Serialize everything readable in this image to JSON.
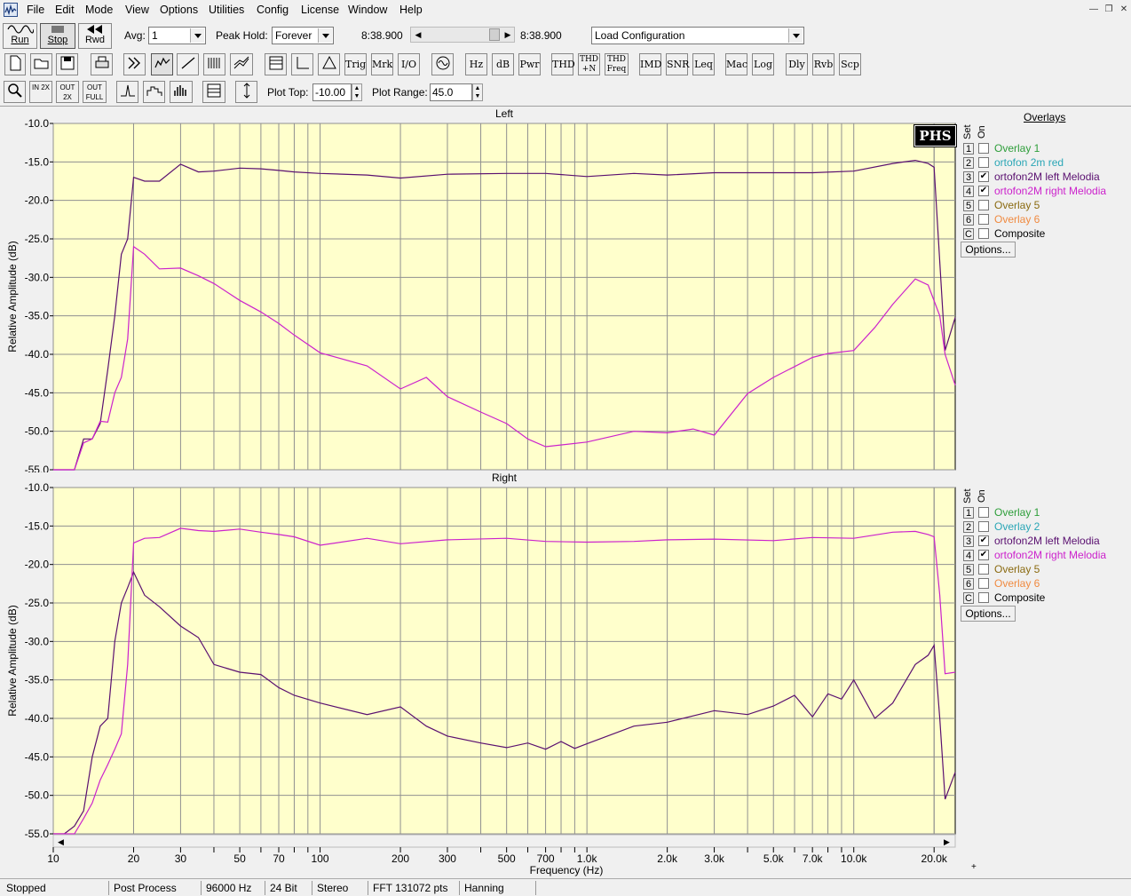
{
  "menu": [
    "File",
    "Edit",
    "Mode",
    "View",
    "Options",
    "Utilities",
    "Config",
    "License",
    "Window",
    "Help"
  ],
  "toolbar1": {
    "run_label": "Run",
    "stop_label": "Stop",
    "rwd_label": "Rwd",
    "avg_label": "Avg:",
    "avg_value": "1",
    "peak_hold_label": "Peak Hold:",
    "peak_hold_value": "Forever",
    "time_start": "8:38.900",
    "time_end": "8:38.900",
    "config_value": "Load Configuration"
  },
  "toolbar2": [
    "Trig",
    "Mrk",
    "I/O",
    "Hz",
    "dB",
    "Pwr",
    "THD",
    "THD +N",
    "THD Freq",
    "IMD",
    "SNR",
    "Leq",
    "Mac",
    "Log",
    "Dly",
    "Rvb",
    "Scp"
  ],
  "toolbar3": {
    "zoom_in_label": "IN 2X",
    "zoom_out_label": "OUT 2X",
    "zoom_full_label": "OUT FULL",
    "plot_top_label": "Plot Top:",
    "plot_top_value": "-10.00",
    "plot_range_label": "Plot Range:",
    "plot_range_value": "45.0"
  },
  "plots": {
    "left_title": "Left",
    "right_title": "Right",
    "ylabel": "Relative Amplitude (dB)",
    "xlabel": "Frequency (Hz)",
    "logo": "PHS",
    "yticks": [
      "-10.0",
      "-15.0",
      "-20.0",
      "-25.0",
      "-30.0",
      "-35.0",
      "-40.0",
      "-45.0",
      "-50.0",
      "-55.0"
    ],
    "xticks": [
      "10",
      "20",
      "30",
      "50",
      "70",
      "100",
      "200",
      "300",
      "500",
      "700",
      "1.0k",
      "2.0k",
      "3.0k",
      "5.0k",
      "7.0k",
      "10.0k",
      "20.0k"
    ]
  },
  "overlays": {
    "title": "Overlays",
    "set_label": "Set",
    "on_label": "On",
    "options_label": "Options...",
    "left": [
      {
        "num": "1",
        "label": "Overlay 1",
        "checked": false,
        "color": "#2e9e3a"
      },
      {
        "num": "2",
        "label": "ortofon 2m red",
        "checked": false,
        "color": "#2aa6b6"
      },
      {
        "num": "3",
        "label": "ortofon2M left Melodia",
        "checked": true,
        "color": "#5a1070"
      },
      {
        "num": "4",
        "label": "ortofon2M right Melodia",
        "checked": true,
        "color": "#cc22cc"
      },
      {
        "num": "5",
        "label": "Overlay 5",
        "checked": false,
        "color": "#8a6a10"
      },
      {
        "num": "6",
        "label": "Overlay 6",
        "checked": false,
        "color": "#f08a40"
      },
      {
        "num": "C",
        "label": "Composite",
        "checked": false,
        "color": "#000000"
      }
    ],
    "right": [
      {
        "num": "1",
        "label": "Overlay 1",
        "checked": false,
        "color": "#2e9e3a"
      },
      {
        "num": "2",
        "label": "Overlay 2",
        "checked": false,
        "color": "#2aa6b6"
      },
      {
        "num": "3",
        "label": "ortofon2M left Melodia",
        "checked": true,
        "color": "#5a1070"
      },
      {
        "num": "4",
        "label": "ortofon2M right Melodia",
        "checked": true,
        "color": "#cc22cc"
      },
      {
        "num": "5",
        "label": "Overlay 5",
        "checked": false,
        "color": "#8a6a10"
      },
      {
        "num": "6",
        "label": "Overlay 6",
        "checked": false,
        "color": "#f08a40"
      },
      {
        "num": "C",
        "label": "Composite",
        "checked": false,
        "color": "#000000"
      }
    ]
  },
  "status": [
    "Stopped",
    "Post Process",
    "96000 Hz",
    "24 Bit",
    "Stereo",
    "FFT 131072 pts",
    "Hanning"
  ],
  "colors": {
    "plot_bg": "#ffffcc",
    "grid": "#909090",
    "series_dark": "#5a1070",
    "series_magenta": "#cc22cc"
  },
  "chart_data": [
    {
      "type": "line",
      "title": "Left",
      "xlabel": "Frequency (Hz)",
      "ylabel": "Relative Amplitude (dB)",
      "xscale": "log",
      "xlim": [
        10,
        24000
      ],
      "ylim": [
        -55,
        -10
      ],
      "series": [
        {
          "name": "ortofon2M left Melodia",
          "color": "#5a1070",
          "x": [
            10,
            11,
            12,
            13,
            14,
            15,
            16,
            17,
            18,
            19,
            20,
            22,
            25,
            30,
            35,
            40,
            50,
            60,
            70,
            80,
            100,
            150,
            200,
            300,
            500,
            700,
            1000,
            1500,
            2000,
            3000,
            5000,
            7000,
            10000,
            14000,
            17000,
            19000,
            20000,
            21000,
            22000,
            24000
          ],
          "y": [
            -55,
            -55,
            -55,
            -51,
            -51,
            -49,
            -42,
            -35,
            -27,
            -25,
            -17,
            -17.5,
            -17.5,
            -15.3,
            -16.3,
            -16.2,
            -15.8,
            -15.9,
            -16.1,
            -16.3,
            -16.5,
            -16.7,
            -17.1,
            -16.6,
            -16.5,
            -16.5,
            -16.9,
            -16.5,
            -16.7,
            -16.4,
            -16.4,
            -16.4,
            -16.2,
            -15.2,
            -14.8,
            -15.2,
            -15.7,
            -28,
            -39.5,
            -35.2
          ]
        },
        {
          "name": "ortofon2M right Melodia",
          "color": "#cc22cc",
          "x": [
            10,
            11,
            12,
            13,
            14,
            15,
            16,
            17,
            18,
            19,
            20,
            22,
            25,
            30,
            35,
            40,
            50,
            60,
            70,
            80,
            100,
            150,
            200,
            250,
            300,
            400,
            500,
            600,
            700,
            1000,
            1500,
            2000,
            2500,
            3000,
            4000,
            5000,
            7000,
            8000,
            10000,
            12000,
            14000,
            17000,
            19000,
            21000,
            22000,
            24000
          ],
          "y": [
            -55,
            -55,
            -55,
            -51.5,
            -51,
            -48.7,
            -48.8,
            -45,
            -43,
            -38,
            -26,
            -27,
            -28.9,
            -28.8,
            -29.8,
            -30.8,
            -33,
            -34.5,
            -36,
            -37.5,
            -39.8,
            -41.5,
            -44.5,
            -43,
            -45.5,
            -47.5,
            -49,
            -51,
            -52,
            -51.4,
            -50,
            -50.2,
            -49.7,
            -50.5,
            -45.1,
            -43,
            -40.4,
            -39.9,
            -39.5,
            -36.5,
            -33.5,
            -30.2,
            -31,
            -35,
            -40,
            -44
          ]
        }
      ]
    },
    {
      "type": "line",
      "title": "Right",
      "xlabel": "Frequency (Hz)",
      "ylabel": "Relative Amplitude (dB)",
      "xscale": "log",
      "xlim": [
        10,
        24000
      ],
      "ylim": [
        -55,
        -10
      ],
      "series": [
        {
          "name": "ortofon2M left Melodia",
          "color": "#5a1070",
          "x": [
            10,
            11,
            12,
            13,
            14,
            15,
            16,
            17,
            18,
            19,
            20,
            22,
            25,
            30,
            35,
            40,
            50,
            60,
            70,
            80,
            100,
            150,
            200,
            250,
            300,
            400,
            500,
            600,
            700,
            800,
            900,
            1000,
            1500,
            2000,
            3000,
            4000,
            5000,
            6000,
            7000,
            8000,
            9000,
            10000,
            12000,
            14000,
            17000,
            19000,
            20000,
            21000,
            22000,
            24000
          ],
          "y": [
            -55,
            -55,
            -54,
            -52,
            -45,
            -41,
            -40,
            -30,
            -25,
            -23,
            -21,
            -24,
            -25.5,
            -28,
            -29.5,
            -33,
            -34,
            -34.3,
            -36,
            -37,
            -38,
            -39.5,
            -38.5,
            -41,
            -42.3,
            -43.2,
            -43.8,
            -43.2,
            -44,
            -43,
            -43.9,
            -43.3,
            -41,
            -40.5,
            -39,
            -39.5,
            -38.4,
            -37,
            -39.8,
            -36.8,
            -37.5,
            -35,
            -40,
            -38,
            -33,
            -31.8,
            -30.5,
            -40,
            -50.5,
            -47
          ]
        },
        {
          "name": "ortofon2M right Melodia",
          "color": "#cc22cc",
          "x": [
            10,
            11,
            12,
            13,
            14,
            15,
            16,
            17,
            18,
            19,
            20,
            22,
            25,
            30,
            35,
            40,
            50,
            60,
            70,
            80,
            100,
            150,
            200,
            300,
            500,
            700,
            1000,
            1500,
            2000,
            3000,
            5000,
            7000,
            10000,
            14000,
            17000,
            19000,
            20000,
            21000,
            22000,
            24000
          ],
          "y": [
            -55,
            -55,
            -55,
            -53,
            -51,
            -48,
            -46,
            -44,
            -42,
            -33,
            -17.2,
            -16.6,
            -16.5,
            -15.3,
            -15.6,
            -15.7,
            -15.4,
            -15.8,
            -16.1,
            -16.4,
            -17.5,
            -16.6,
            -17.3,
            -16.8,
            -16.6,
            -17,
            -17.1,
            -17,
            -16.8,
            -16.7,
            -16.9,
            -16.5,
            -16.6,
            -15.8,
            -15.7,
            -16.1,
            -16.4,
            -24,
            -34.2,
            -34
          ]
        }
      ]
    }
  ]
}
